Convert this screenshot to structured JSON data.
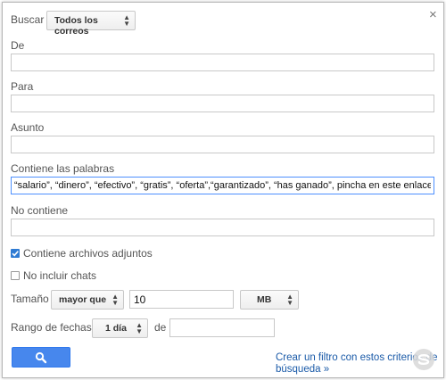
{
  "search": {
    "label": "Buscar",
    "scope_value": "Todos los correos"
  },
  "close_glyph": "×",
  "fields": {
    "from": {
      "label": "De",
      "value": ""
    },
    "to": {
      "label": "Para",
      "value": ""
    },
    "subject": {
      "label": "Asunto",
      "value": ""
    },
    "has_words": {
      "label": "Contiene las palabras",
      "value": "“salario”, “dinero”, “efectivo”, “gratis”, “oferta”,“garantizado”, “has ganado”, pincha en este enlace”"
    },
    "doesnt_have": {
      "label": "No contiene",
      "value": ""
    }
  },
  "options": {
    "has_attachment": {
      "label": "Contiene archivos adjuntos",
      "checked": true
    },
    "no_chats": {
      "label": "No incluir chats",
      "checked": false
    }
  },
  "size": {
    "label": "Tamaño",
    "operator": "mayor que",
    "value": "10",
    "unit": "MB"
  },
  "date": {
    "label": "Rango de fechas",
    "range": "1 día",
    "of_label": "de",
    "value": ""
  },
  "create_filter": {
    "line1": "Crear un filtro con estos criterios de",
    "line2": "búsqueda »"
  },
  "colors": {
    "accent": "#4787ed",
    "link": "#1a5aa8",
    "focus": "#4d90fe"
  },
  "watermark_text": "solvetic.com"
}
